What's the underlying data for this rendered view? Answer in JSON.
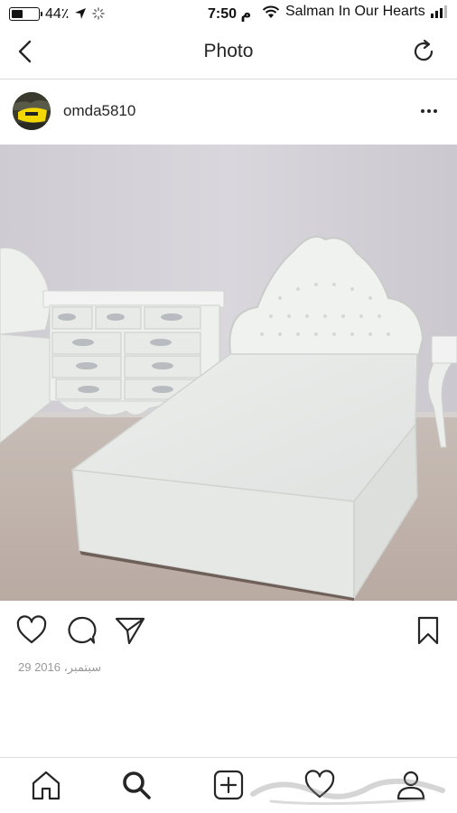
{
  "status_bar": {
    "battery_percent": "44٪",
    "battery_level": 0.44,
    "time": "7:50 م",
    "carrier": "Salman In Our Hearts"
  },
  "nav": {
    "title": "Photo",
    "back_icon": "chevron-left-icon",
    "refresh_icon": "refresh-icon"
  },
  "post": {
    "username": "omda5810",
    "date": "29 سبتمبر، 2016",
    "photo_description_icon": "bedroom-photo"
  },
  "actions": {
    "like_icon": "heart-icon",
    "comment_icon": "comment-icon",
    "share_icon": "send-icon",
    "save_icon": "bookmark-icon"
  },
  "tabs": [
    "home-icon",
    "search-icon",
    "add-icon",
    "heart-icon",
    "profile-icon"
  ],
  "colors": {
    "text": "#262626",
    "muted": "#999999",
    "divider": "#dbdbdb"
  }
}
